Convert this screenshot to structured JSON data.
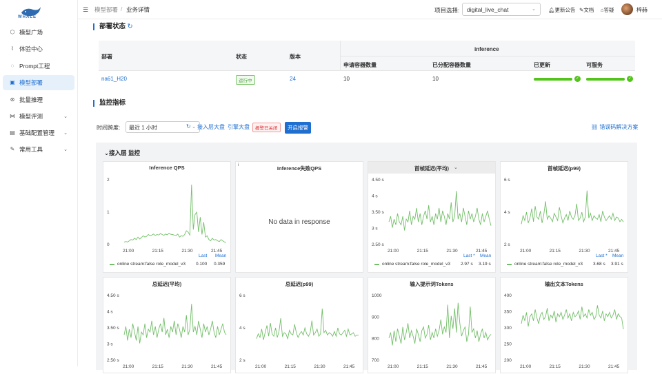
{
  "app": {
    "logo_text": "WHALE"
  },
  "sidebar": {
    "items": [
      {
        "label": "模型广场",
        "icon": "cube-icon",
        "glyph": "⬡"
      },
      {
        "label": "体验中心",
        "icon": "chart-line-icon",
        "glyph": "⌇"
      },
      {
        "label": "Prompt工程",
        "icon": "chat-icon",
        "glyph": "◌"
      },
      {
        "label": "模型部署",
        "icon": "deploy-icon",
        "glyph": "▣"
      },
      {
        "label": "批量推理",
        "icon": "batch-icon",
        "glyph": "⊛"
      },
      {
        "label": "模型评测",
        "icon": "evaluate-icon",
        "glyph": "⋈"
      },
      {
        "label": "基础配置管理",
        "icon": "config-icon",
        "glyph": "▤"
      },
      {
        "label": "常用工具",
        "icon": "tool-icon",
        "glyph": "✎"
      }
    ]
  },
  "topbar": {
    "breadcrumb": [
      "模型部署",
      "/",
      "业务详情"
    ],
    "project_label": "项目选择:",
    "project_value": "digital_live_chat",
    "links": [
      "更新公告",
      "文档",
      "答疑"
    ],
    "user": "梓赫"
  },
  "deploy": {
    "title": "部署状态",
    "headers": {
      "deploy": "部署",
      "status": "状态",
      "version": "版本",
      "inference": "inference",
      "requested": "申请容器数量",
      "allocated": "已分配容器数量",
      "updated": "已更新",
      "serviceable": "可服务"
    },
    "row": {
      "deploy": "na61_H20",
      "status": "运行中",
      "version": "24",
      "requested": "10",
      "allocated": "10",
      "updated_progress": 1.0,
      "serviceable_progress": 1.0
    }
  },
  "monitor": {
    "title": "监控指标",
    "time_label": "时间跨度:",
    "time_value": "最近 1 小时",
    "links": [
      "接入层大盘",
      "引擎大盘"
    ],
    "alarm_badge": "报警已关闭",
    "alarm_button": "开启报警",
    "help_link": "错误码解决方案",
    "group_title": "接入层 监控",
    "colors": {
      "line": "#73bf69",
      "accent": "#1f6fd0"
    }
  },
  "panels": [
    {
      "title": "Inference QPS",
      "yticks": [
        "2",
        "1",
        "0"
      ],
      "xticks": [
        "21:00",
        "21:15",
        "21:30",
        "21:45"
      ],
      "legend": "online stream:false role_model_v3",
      "last_label": "Last",
      "mean_label": "Mean",
      "last": "0.100",
      "mean": "0.359"
    },
    {
      "title": "Inference失败QPS",
      "nodata": "No data in response",
      "info": "i"
    },
    {
      "title": "首帧延迟(平均)",
      "highlight": true,
      "yticks": [
        "4.50 s",
        "4 s",
        "3.50 s",
        "3 s",
        "2.50 s"
      ],
      "xticks": [
        "21:00",
        "21:15",
        "21:30",
        "21:45"
      ],
      "legend": "online stream:false role_model_v3",
      "last_label": "Last *",
      "mean_label": "Mean",
      "last": "2.97 s",
      "mean": "3.19 s"
    },
    {
      "title": "首帧延迟(p99)",
      "yticks": [
        "6 s",
        "4 s",
        "2 s"
      ],
      "xticks": [
        "21:00",
        "21:15",
        "21:30",
        "21:45"
      ],
      "legend": "online stream:false role_model_v3",
      "last_label": "Last *",
      "mean_label": "Mean",
      "last": "3.68 s",
      "mean": "3.91 s"
    },
    {
      "title": "总延迟(平均)",
      "yticks": [
        "4.50 s",
        "4 s",
        "3.50 s",
        "3 s",
        "2.50 s"
      ],
      "xticks": [
        "21:00",
        "21:15",
        "21:30",
        "21:45"
      ]
    },
    {
      "title": "总延迟(p99)",
      "yticks": [
        "6 s",
        "4 s",
        "2 s"
      ],
      "xticks": [
        "21:00",
        "21:15",
        "21:30",
        "21:45"
      ]
    },
    {
      "title": "输入提示词Tokens",
      "yticks": [
        "1000",
        "900",
        "800",
        "700"
      ],
      "xticks": [
        "21:00",
        "21:15",
        "21:30",
        "21:45"
      ]
    },
    {
      "title": "输出文本Tokens",
      "yticks": [
        "400",
        "350",
        "300",
        "250",
        "200"
      ],
      "xticks": [
        "21:00",
        "21:15",
        "21:30",
        "21:45"
      ]
    }
  ],
  "chart_data": [
    {
      "type": "line",
      "title": "Inference QPS",
      "series": [
        {
          "name": "online stream:false role_model_v3",
          "values": [
            0.1,
            0.12,
            0.1,
            0.15,
            0.2,
            0.18,
            0.25,
            0.2,
            0.3,
            0.22,
            0.28,
            0.35,
            0.3,
            0.33,
            0.4,
            0.35,
            0.38,
            0.42,
            0.36,
            0.4,
            0.38,
            0.44,
            0.4,
            0.37,
            0.42,
            0.39,
            0.45,
            0.41,
            0.4,
            0.38,
            0.36,
            0.42,
            0.3,
            0.35,
            0.33,
            0.4,
            0.55,
            0.5,
            0.38,
            2.4,
            0.6,
            1.2,
            1.3,
            0.5,
            1.1,
            0.4,
            0.9,
            0.3,
            0.35,
            0.2,
            0.15,
            0.25,
            0.18,
            0.2,
            0.15,
            0.12,
            0.2,
            0.15,
            0.1,
            0.1
          ]
        }
      ],
      "ylim": [
        0,
        2.6
      ],
      "xlabels": [
        "21:00",
        "21:15",
        "21:30",
        "21:45"
      ]
    },
    {
      "type": "line",
      "title": "首帧延迟(平均)",
      "series": [
        {
          "name": "online stream:false role_model_v3",
          "values": [
            3.1,
            3.3,
            2.9,
            3.2,
            3.0,
            3.4,
            3.1,
            3.0,
            3.3,
            2.8,
            3.2,
            3.1,
            3.5,
            3.0,
            3.3,
            3.2,
            3.6,
            3.1,
            3.4,
            3.0,
            3.3,
            3.5,
            3.2,
            3.7,
            3.1,
            3.3,
            3.0,
            3.4,
            3.2,
            3.6,
            3.1,
            3.5,
            3.3,
            3.0,
            3.4,
            3.2,
            3.8,
            3.1,
            3.3,
            4.2,
            3.2,
            3.4,
            3.1,
            3.6,
            3.3,
            3.0,
            3.5,
            3.2,
            3.4,
            3.1,
            3.3,
            3.6,
            3.2,
            3.0,
            3.4,
            3.1,
            3.3,
            3.5,
            3.2,
            2.97
          ]
        }
      ],
      "ylim": [
        2.3,
        4.6
      ],
      "xlabels": [
        "21:00",
        "21:15",
        "21:30",
        "21:45"
      ]
    },
    {
      "type": "line",
      "title": "首帧延迟(p99)",
      "series": [
        {
          "name": "online stream:false role_model_v3",
          "values": [
            3.5,
            4.2,
            3.8,
            4.5,
            3.6,
            4.0,
            4.8,
            3.7,
            5.0,
            4.1,
            3.9,
            4.6,
            3.6,
            4.3,
            5.4,
            3.9,
            4.2,
            4.0,
            3.7,
            4.4,
            4.1,
            3.8,
            4.9,
            4.2,
            3.6,
            4.0,
            4.3,
            3.8,
            4.6,
            4.1,
            3.9,
            4.2,
            5.2,
            3.8,
            4.0,
            4.5,
            3.7,
            4.1,
            6.3,
            4.0,
            4.4,
            3.8,
            4.2,
            4.0,
            3.9,
            4.3,
            3.7,
            4.6,
            4.1,
            3.8,
            4.0,
            4.2,
            3.9,
            4.4,
            3.8,
            4.1,
            4.0,
            3.7,
            3.9,
            3.68
          ]
        }
      ],
      "ylim": [
        1.8,
        7.2
      ],
      "xlabels": [
        "21:00",
        "21:15",
        "21:30",
        "21:45"
      ]
    },
    {
      "type": "line",
      "title": "总延迟(平均)",
      "series": [
        {
          "values": [
            3.2,
            3.5,
            3.0,
            3.4,
            3.1,
            3.6,
            3.3,
            3.0,
            3.5,
            2.9,
            3.3,
            3.2,
            3.6,
            3.1,
            3.4,
            3.3,
            3.7,
            3.2,
            3.5,
            3.1,
            3.4,
            3.6,
            3.3,
            3.8,
            3.2,
            3.4,
            3.1,
            3.5,
            3.3,
            3.7,
            3.2,
            3.6,
            3.4,
            3.1,
            3.5,
            3.3,
            3.9,
            3.2,
            3.4,
            4.3,
            3.3,
            3.5,
            3.2,
            3.7,
            3.4,
            3.1,
            3.6,
            3.3,
            3.5,
            3.2,
            3.4,
            3.7,
            3.3,
            3.1,
            3.5,
            3.2,
            3.4,
            3.6,
            3.3,
            3.2
          ]
        }
      ],
      "ylim": [
        2.3,
        4.6
      ],
      "xlabels": [
        "21:00",
        "21:15",
        "21:30",
        "21:45"
      ]
    },
    {
      "type": "line",
      "title": "总延迟(p99)",
      "series": [
        {
          "values": [
            3.6,
            4.0,
            3.7,
            4.4,
            3.5,
            4.1,
            4.7,
            3.8,
            4.9,
            4.0,
            3.8,
            4.5,
            3.7,
            4.2,
            5.3,
            3.8,
            4.1,
            4.0,
            3.6,
            4.3,
            4.0,
            3.9,
            4.8,
            4.1,
            3.7,
            4.0,
            4.2,
            3.9,
            4.5,
            4.0,
            3.8,
            4.1,
            5.1,
            3.9,
            4.1,
            4.4,
            3.8,
            4.0,
            6.1,
            4.1,
            4.3,
            3.9,
            4.1,
            4.0,
            3.8,
            4.2,
            3.8,
            4.5,
            4.0,
            3.9,
            4.1,
            4.3,
            3.8,
            4.4,
            3.9,
            4.0,
            4.1,
            3.8,
            3.9,
            3.9
          ]
        }
      ],
      "ylim": [
        1.8,
        7.2
      ],
      "xlabels": [
        "21:00",
        "21:15",
        "21:30",
        "21:45"
      ]
    },
    {
      "type": "line",
      "title": "输入提示词Tokens",
      "series": [
        {
          "values": [
            820,
            850,
            780,
            860,
            800,
            870,
            830,
            790,
            880,
            810,
            850,
            900,
            820,
            860,
            830,
            790,
            870,
            840,
            800,
            860,
            880,
            820,
            840,
            890,
            810,
            850,
            820,
            870,
            830,
            860,
            920,
            840,
            880,
            850,
            1000,
            820,
            940,
            870,
            980,
            850,
            1010,
            900,
            830,
            860,
            880,
            800,
            840,
            990,
            850,
            870,
            820,
            860,
            800,
            840,
            870,
            820,
            850,
            810,
            830,
            840
          ]
        }
      ],
      "ylim": [
        700,
        1050
      ],
      "xlabels": [
        "21:00",
        "21:15",
        "21:30",
        "21:45"
      ]
    },
    {
      "type": "line",
      "title": "输出文本Tokens",
      "series": [
        {
          "values": [
            320,
            350,
            330,
            360,
            310,
            345,
            355,
            330,
            370,
            340,
            320,
            350,
            360,
            335,
            345,
            375,
            330,
            350,
            340,
            365,
            325,
            355,
            345,
            360,
            335,
            350,
            370,
            340,
            355,
            330,
            360,
            345,
            350,
            365,
            335,
            380,
            345,
            355,
            340,
            370,
            350,
            360,
            335,
            345,
            385,
            350,
            340,
            365,
            330,
            355,
            345,
            360,
            340,
            350,
            370,
            335,
            355,
            345,
            340,
            300
          ]
        }
      ],
      "ylim": [
        190,
        420
      ],
      "xlabels": [
        "21:00",
        "21:15",
        "21:30",
        "21:45"
      ]
    }
  ]
}
